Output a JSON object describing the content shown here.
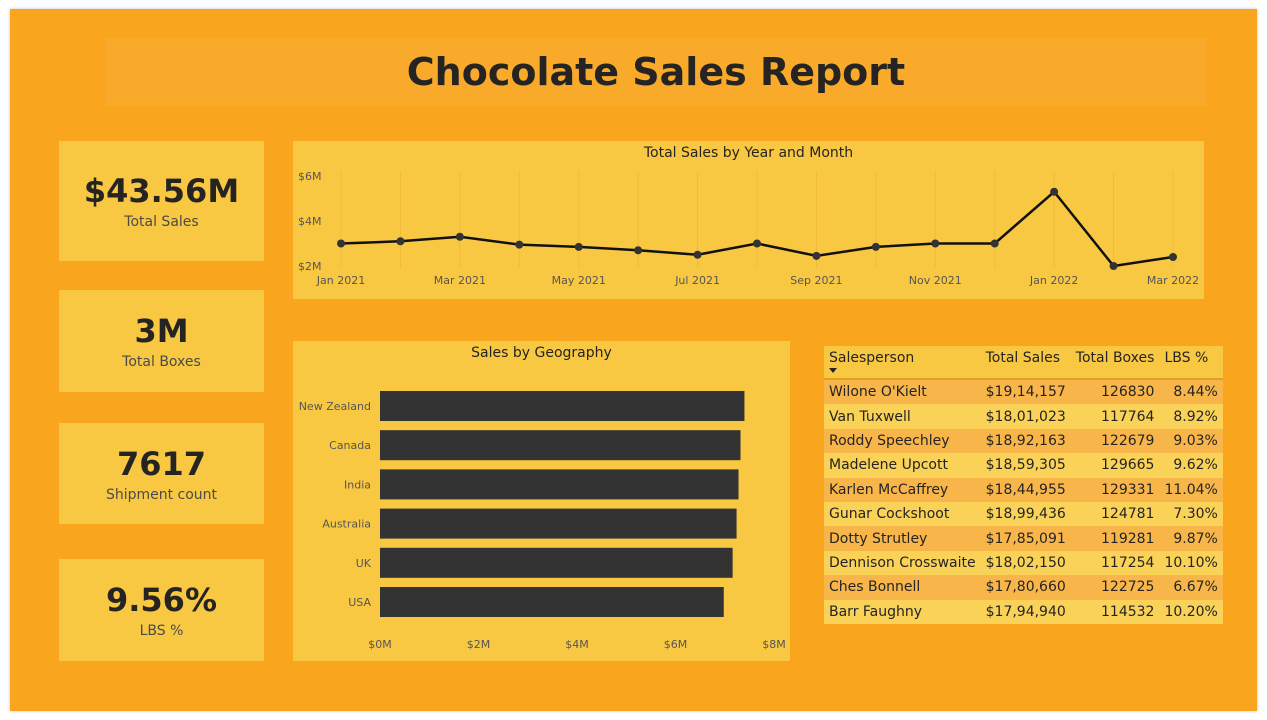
{
  "title": "Chocolate Sales Report",
  "kpis": {
    "total_sales": {
      "value": "$43.56M",
      "label": "Total Sales"
    },
    "total_boxes": {
      "value": "3M",
      "label": "Total Boxes"
    },
    "shipment_count": {
      "value": "7617",
      "label": "Shipment count"
    },
    "lbs_pct": {
      "value": "9.56%",
      "label": "LBS %"
    }
  },
  "chart_data": [
    {
      "type": "line",
      "title": "Total Sales by Year and Month",
      "x": [
        "Jan 2021",
        "Feb 2021",
        "Mar 2021",
        "Apr 2021",
        "May 2021",
        "Jun 2021",
        "Jul 2021",
        "Aug 2021",
        "Sep 2021",
        "Oct 2021",
        "Nov 2021",
        "Dec 2021",
        "Jan 2022",
        "Feb 2022",
        "Mar 2022"
      ],
      "x_tick_labels": [
        "Jan 2021",
        "Mar 2021",
        "May 2021",
        "Jul 2021",
        "Sep 2021",
        "Nov 2021",
        "Jan 2022",
        "Mar 2022"
      ],
      "values": [
        3.0,
        3.1,
        3.3,
        2.95,
        2.85,
        2.7,
        2.5,
        3.0,
        2.45,
        2.85,
        3.0,
        3.0,
        5.3,
        2.0,
        2.4
      ],
      "y_ticks": [
        "$2M",
        "$4M",
        "$6M"
      ],
      "ylim": [
        2,
        6
      ],
      "unit": "millions USD",
      "line_color": "#111111"
    },
    {
      "type": "bar",
      "orientation": "horizontal",
      "title": "Sales by Geography",
      "categories": [
        "New Zealand",
        "Canada",
        "India",
        "Australia",
        "UK",
        "USA"
      ],
      "values": [
        7.4,
        7.32,
        7.28,
        7.24,
        7.16,
        6.98
      ],
      "x_ticks": [
        "$0M",
        "$2M",
        "$4M",
        "$6M",
        "$8M"
      ],
      "xlim": [
        0,
        8
      ],
      "unit": "millions USD",
      "bar_color": "#333333"
    }
  ],
  "table": {
    "headers": [
      "Salesperson",
      "Total Sales",
      "Total Boxes",
      "LBS %"
    ],
    "rows": [
      [
        "Wilone O'Kielt",
        "$19,14,157",
        "126830",
        "8.44%"
      ],
      [
        "Van Tuxwell",
        "$18,01,023",
        "117764",
        "8.92%"
      ],
      [
        "Roddy Speechley",
        "$18,92,163",
        "122679",
        "9.03%"
      ],
      [
        "Madelene Upcott",
        "$18,59,305",
        "129665",
        "9.62%"
      ],
      [
        "Karlen McCaffrey",
        "$18,44,955",
        "129331",
        "11.04%"
      ],
      [
        "Gunar Cockshoot",
        "$18,99,436",
        "124781",
        "7.30%"
      ],
      [
        "Dotty Strutley",
        "$17,85,091",
        "119281",
        "9.87%"
      ],
      [
        "Dennison Crosswaite",
        "$18,02,150",
        "117254",
        "10.10%"
      ],
      [
        "Ches Bonnell",
        "$17,80,660",
        "122725",
        "6.67%"
      ],
      [
        "Barr Faughny",
        "$17,94,940",
        "114532",
        "10.20%"
      ]
    ]
  },
  "colors": {
    "background": "#f9a51e",
    "card": "#f9c842",
    "row_odd": "#f8b64a",
    "row_even": "#f9d257"
  }
}
